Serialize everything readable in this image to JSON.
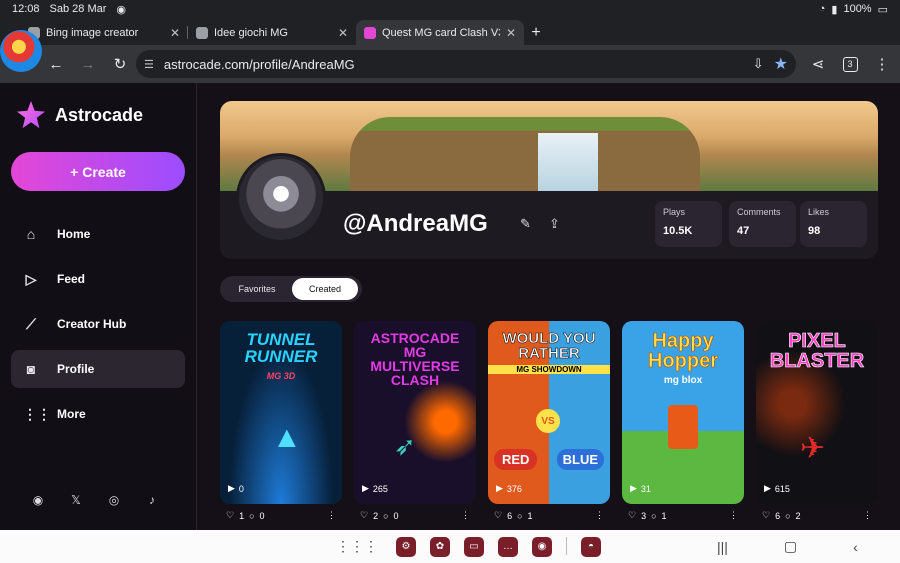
{
  "status": {
    "time": "12:08",
    "date": "Sab 28 Mar",
    "battery": "100%"
  },
  "tabs": [
    {
      "title": "Bing image creator",
      "active": false
    },
    {
      "title": "Idee giochi MG",
      "active": false
    },
    {
      "title": "Quest MG card Clash V3",
      "active": true
    }
  ],
  "browser": {
    "url": "astrocade.com/profile/AndreaMG",
    "tab_count": "3",
    "new_tab": "+"
  },
  "sidebar": {
    "brand": "Astrocade",
    "create_label": "+ Create",
    "items": [
      {
        "label": "Home",
        "icon": "home-icon"
      },
      {
        "label": "Feed",
        "icon": "play-icon"
      },
      {
        "label": "Creator Hub",
        "icon": "chart-icon"
      },
      {
        "label": "Profile",
        "icon": "profile-icon"
      },
      {
        "label": "More",
        "icon": "grid-icon"
      }
    ],
    "socials": [
      "discord-icon",
      "x-icon",
      "instagram-icon",
      "tiktok-icon"
    ]
  },
  "profile": {
    "handle": "@AndreaMG",
    "stats": [
      {
        "label": "Plays",
        "value": "10.5K"
      },
      {
        "label": "Comments",
        "value": "47"
      },
      {
        "label": "Likes",
        "value": "98"
      }
    ],
    "tabs": [
      {
        "label": "Favorites",
        "active": false
      },
      {
        "label": "Created",
        "active": true
      }
    ]
  },
  "games": [
    {
      "title": "TUNNEL RUNNER",
      "subtitle": "MG 3D",
      "plays": "0",
      "likes": "1",
      "comments": "0",
      "title_color": "#29d3ff",
      "bg": "#07203a"
    },
    {
      "title": "ASTROCADE MG MULTIVERSE CLASH",
      "subtitle": "",
      "plays": "265",
      "likes": "2",
      "comments": "0",
      "title_color": "#e23be6",
      "bg": "#1a0f2a"
    },
    {
      "title": "WOULD YOU RATHER",
      "subtitle": "MG SHOWDOWN",
      "plays": "376",
      "likes": "6",
      "comments": "1",
      "title_color": "#ffffff",
      "bg": "#e05a1e",
      "left_label": "RED",
      "right_label": "BLUE"
    },
    {
      "title": "Happy Hopper",
      "subtitle": "mg blox",
      "plays": "31",
      "likes": "3",
      "comments": "1",
      "title_color": "#ffe14a",
      "bg": "#3aa3e8"
    },
    {
      "title": "PIXEL BLASTER",
      "subtitle": "",
      "plays": "615",
      "likes": "6",
      "comments": "2",
      "title_color": "#ff44c8",
      "bg": "#111014"
    }
  ]
}
